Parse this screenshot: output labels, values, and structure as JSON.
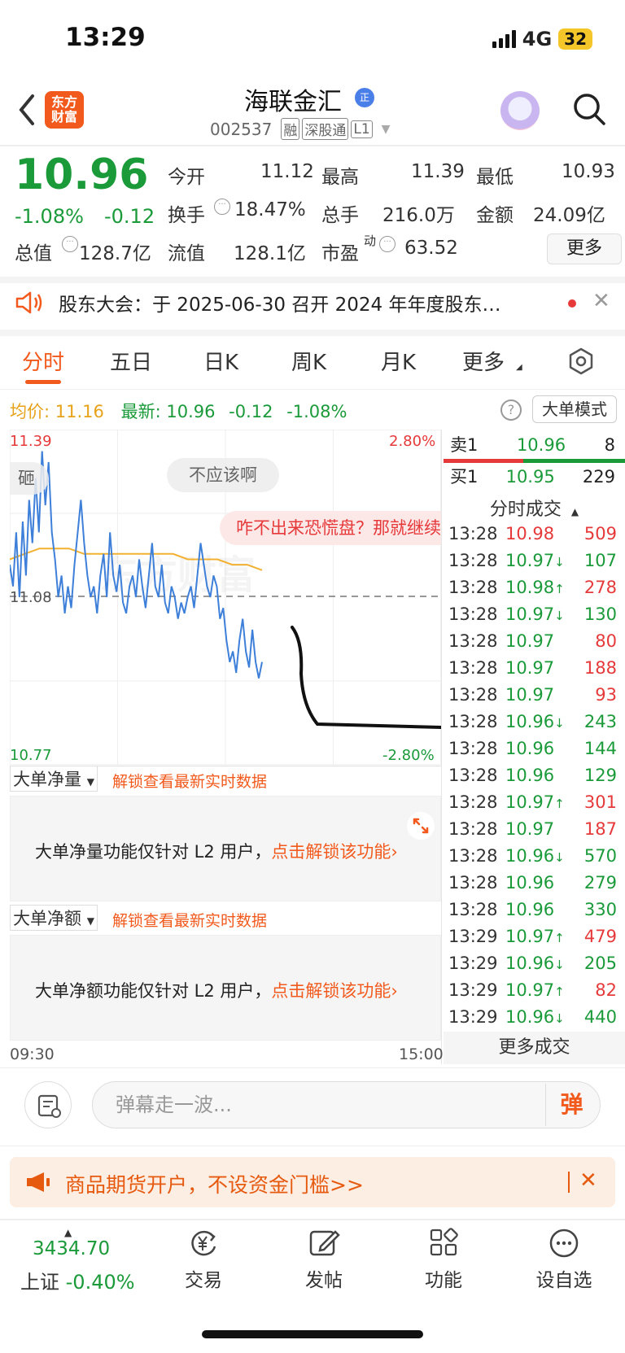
{
  "status": {
    "time": "13:29",
    "network": "4G",
    "battery": "32"
  },
  "header": {
    "logo": [
      "东方",
      "财富"
    ],
    "name": "海联金汇",
    "verify_badge": "正",
    "code": "002537",
    "tags": [
      "融",
      "深股通",
      "L1"
    ]
  },
  "quote": {
    "price": "10.96",
    "change_pct": "-1.08%",
    "change": "-0.12",
    "fields": [
      {
        "label": "今开",
        "value": "11.12",
        "color": "red"
      },
      {
        "label": "最高",
        "value": "11.39",
        "color": "red"
      },
      {
        "label": "最低",
        "value": "10.93",
        "color": "green"
      },
      {
        "label": "换手",
        "value": "18.47%",
        "color": "plain"
      },
      {
        "label": "总手",
        "value": "216.0万",
        "color": "plain"
      },
      {
        "label": "金额",
        "value": "24.09亿",
        "color": "plain"
      },
      {
        "label": "总值",
        "value": "128.7亿",
        "color": "plain"
      },
      {
        "label": "流值",
        "value": "128.1亿",
        "color": "plain"
      },
      {
        "label": "市盈",
        "sup": "动",
        "value": "63.52",
        "color": "plain"
      }
    ],
    "more": "更多"
  },
  "notice": {
    "text": "股东大会：于 2025-06-30 召开 2024 年年度股东…"
  },
  "tabs": [
    "分时",
    "五日",
    "日K",
    "周K",
    "月K",
    "更多"
  ],
  "info": {
    "avg_label": "均价:",
    "avg": "11.16",
    "latest_label": "最新:",
    "latest": "10.96",
    "chg": "-0.12",
    "pct": "-1.08%",
    "mode_btn": "大单模式"
  },
  "chart_data": {
    "type": "line",
    "title": "",
    "y_top": "11.39",
    "y_mid": "11.08",
    "y_bot": "10.77",
    "pct_top": "2.80%",
    "pct_bot": "-2.80%",
    "ylim": [
      10.77,
      11.39
    ],
    "x_start": "09:30",
    "x_end": "15:00",
    "series": [
      {
        "values": [
          11.14,
          11.1,
          11.2,
          11.08,
          11.22,
          11.12,
          11.26,
          11.18,
          11.3,
          11.2,
          11.35,
          11.25,
          11.33,
          11.2,
          11.15,
          11.08,
          11.12,
          11.05,
          11.1,
          11.06,
          11.14,
          11.2,
          11.26,
          11.18,
          11.12,
          11.08,
          11.1,
          11.05,
          11.12,
          11.16,
          11.08,
          11.2,
          11.12,
          11.09,
          11.14,
          11.07,
          11.05,
          11.1,
          11.12,
          11.08,
          11.15,
          11.1,
          11.06,
          11.12,
          11.18,
          11.1,
          11.08,
          11.14,
          11.07,
          11.05,
          11.1,
          11.08,
          11.04,
          11.07,
          11.05,
          11.08,
          11.1,
          11.06,
          11.12,
          11.18,
          11.14,
          11.1,
          11.08,
          11.12,
          11.1,
          11.04,
          11.06,
          11.0,
          10.96,
          10.98,
          10.94,
          11.0,
          11.04,
          10.98,
          10.95,
          11.02,
          10.96,
          10.93,
          10.96
        ]
      },
      {
        "values": [
          11.15,
          11.16,
          11.17,
          11.17,
          11.17,
          11.16,
          11.16,
          11.16,
          11.16,
          11.16,
          11.16,
          11.16,
          11.15,
          11.15,
          11.15,
          11.14,
          11.14,
          11.13
        ]
      }
    ]
  },
  "danmu": [
    "砸",
    "不应该啊",
    "咋不出来恐慌盘？那就继续"
  ],
  "orderbook": {
    "sell": {
      "label": "卖1",
      "price": "10.96",
      "vol": "8"
    },
    "buy": {
      "label": "买1",
      "price": "10.95",
      "vol": "229"
    }
  },
  "trades_title": "分时成交",
  "trades": [
    {
      "t": "13:28",
      "p": "10.98",
      "a": "",
      "v": "509",
      "c": "red",
      "vc": "red"
    },
    {
      "t": "13:28",
      "p": "10.97",
      "a": "↓",
      "v": "107",
      "c": "green",
      "vc": "green"
    },
    {
      "t": "13:28",
      "p": "10.98",
      "a": "↑",
      "v": "278",
      "c": "green",
      "vc": "red"
    },
    {
      "t": "13:28",
      "p": "10.97",
      "a": "↓",
      "v": "130",
      "c": "green",
      "vc": "green"
    },
    {
      "t": "13:28",
      "p": "10.97",
      "a": "",
      "v": "80",
      "c": "green",
      "vc": "red"
    },
    {
      "t": "13:28",
      "p": "10.97",
      "a": "",
      "v": "188",
      "c": "green",
      "vc": "red"
    },
    {
      "t": "13:28",
      "p": "10.97",
      "a": "",
      "v": "93",
      "c": "green",
      "vc": "red"
    },
    {
      "t": "13:28",
      "p": "10.96",
      "a": "↓",
      "v": "243",
      "c": "green",
      "vc": "green"
    },
    {
      "t": "13:28",
      "p": "10.96",
      "a": "",
      "v": "144",
      "c": "green",
      "vc": "green"
    },
    {
      "t": "13:28",
      "p": "10.96",
      "a": "",
      "v": "129",
      "c": "green",
      "vc": "green"
    },
    {
      "t": "13:28",
      "p": "10.97",
      "a": "↑",
      "v": "301",
      "c": "green",
      "vc": "red"
    },
    {
      "t": "13:28",
      "p": "10.97",
      "a": "",
      "v": "187",
      "c": "green",
      "vc": "red"
    },
    {
      "t": "13:28",
      "p": "10.96",
      "a": "↓",
      "v": "570",
      "c": "green",
      "vc": "green"
    },
    {
      "t": "13:28",
      "p": "10.96",
      "a": "",
      "v": "279",
      "c": "green",
      "vc": "green"
    },
    {
      "t": "13:28",
      "p": "10.96",
      "a": "",
      "v": "330",
      "c": "green",
      "vc": "green"
    },
    {
      "t": "13:29",
      "p": "10.97",
      "a": "↑",
      "v": "479",
      "c": "green",
      "vc": "red"
    },
    {
      "t": "13:29",
      "p": "10.96",
      "a": "↓",
      "v": "205",
      "c": "green",
      "vc": "green"
    },
    {
      "t": "13:29",
      "p": "10.97",
      "a": "↑",
      "v": "82",
      "c": "green",
      "vc": "red"
    },
    {
      "t": "13:29",
      "p": "10.96",
      "a": "↓",
      "v": "440",
      "c": "green",
      "vc": "green"
    }
  ],
  "more_trades": "更多成交",
  "l2": {
    "panel1_label": "大单净量",
    "panel2_label": "大单净额",
    "unlock_link": "解锁查看最新实时数据",
    "panel1_text": "大单净量功能仅针对 L2 用户，",
    "panel2_text": "大单净额功能仅针对 L2 用户，",
    "unlock_cta": "点击解锁该功能›"
  },
  "comment": {
    "placeholder": "弹幕走一波...",
    "dan": "弹"
  },
  "ad": {
    "text": "商品期货开户，不设资金门槛>>"
  },
  "bottom": {
    "index_value": "3434.70",
    "index_name": "上证",
    "index_pct": "-0.40%",
    "nav": [
      "交易",
      "发帖",
      "功能",
      "设自选"
    ]
  },
  "colors": {
    "accent": "#f25a1d",
    "up": "#e6393a",
    "down": "#1b9a3a"
  }
}
